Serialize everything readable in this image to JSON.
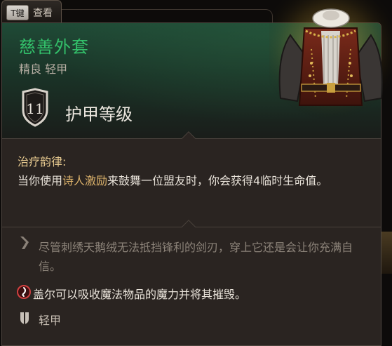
{
  "hotkey": {
    "key": "T键",
    "label": "查看"
  },
  "item": {
    "name": "慈善外套",
    "rarity_type": "精良 轻甲",
    "name_color": "#33c06a",
    "armor_class_value": "11",
    "armor_class_label": "护甲等级",
    "image_icon": "ornate-doublet-icon"
  },
  "passive": {
    "title": "治疗韵律:",
    "desc_prefix": "当你使用",
    "desc_highlight": "诗人激励",
    "desc_suffix": "来鼓舞一位盟友时，你会获得4临时生命值。"
  },
  "flavor": {
    "icon": "quill-icon",
    "text": "尽管刺绣天鹅绒无法抵挡锋利的剑刃，穿上它还是会让你充满自信。"
  },
  "note": {
    "icon": "warning-swirl-icon",
    "text": "盖尔可以吸收魔法物品的魔力并将其摧毁。"
  },
  "armor_type": {
    "icon": "light-armor-icon",
    "text": "轻甲"
  }
}
